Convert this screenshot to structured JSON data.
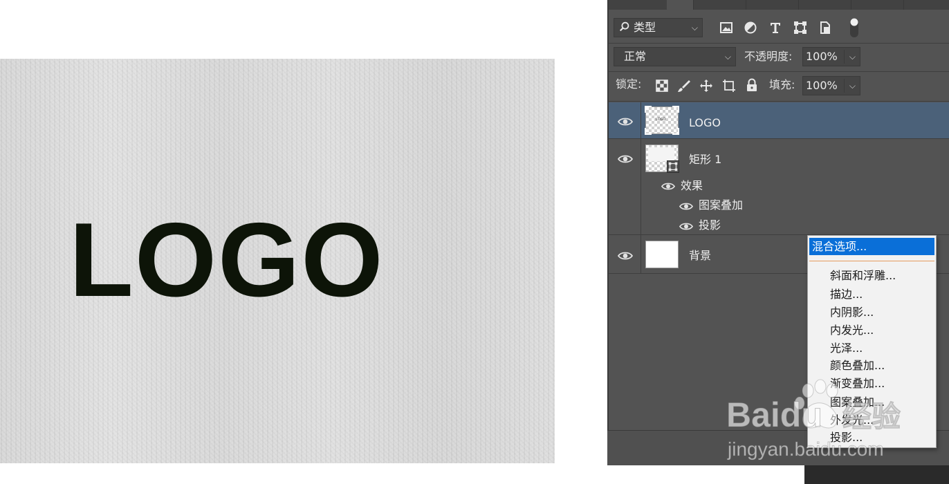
{
  "canvas": {
    "logo_text": "LOGO"
  },
  "layers_panel": {
    "filter": {
      "label": "类型",
      "icons": [
        "image-filter-icon",
        "adjustment-filter-icon",
        "type-filter-icon",
        "shape-filter-icon",
        "smart-object-filter-icon",
        "filter-toggle-icon"
      ]
    },
    "blend_mode": "正常",
    "opacity_label": "不透明度:",
    "opacity_value": "100%",
    "lock_label": "锁定:",
    "lock_icons": [
      "lock-transparent-pixels-icon",
      "lock-image-pixels-icon",
      "lock-position-icon",
      "lock-artboard-icon",
      "lock-all-icon"
    ],
    "fill_label": "填充:",
    "fill_value": "100%",
    "layers": [
      {
        "name": "LOGO",
        "selected": true
      },
      {
        "name": "矩形 1",
        "effects_label": "效果",
        "effects": [
          "图案叠加",
          "投影"
        ]
      },
      {
        "name": "背景"
      }
    ]
  },
  "context_menu": {
    "highlighted": "混合选项...",
    "items": [
      "斜面和浮雕...",
      "描边...",
      "内阴影...",
      "内发光...",
      "光泽...",
      "颜色叠加...",
      "渐变叠加...",
      "图案叠加...",
      "外发光...",
      "投影..."
    ]
  },
  "watermark": {
    "brand": "Baidu",
    "brand_cn": "经验",
    "url": "jingyan.baidu.com"
  },
  "colors": {
    "panel_bg": "#535353",
    "selected_layer": "#4b6179",
    "menu_highlight": "#0a6fd8",
    "logo_text": "#0d1408"
  }
}
